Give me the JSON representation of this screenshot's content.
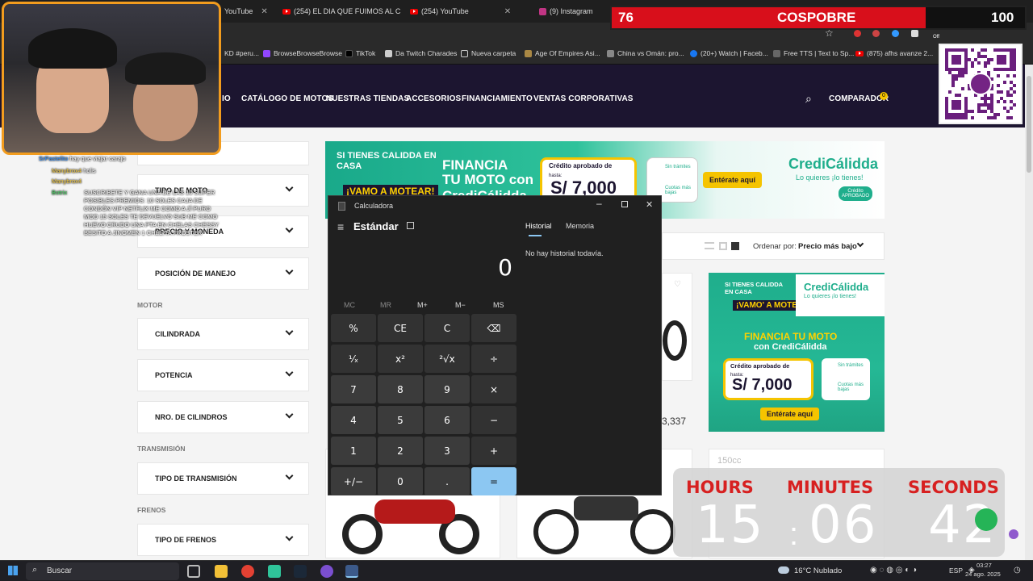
{
  "browser": {
    "tabs": [
      {
        "label": "YouTube"
      },
      {
        "label": "(254) EL DIA QUE FUIMOS AL C"
      },
      {
        "label": "(254) YouTube"
      },
      {
        "label": "(9) Instagram"
      }
    ],
    "bookmarks": [
      "KD #peru...",
      "BrowseBrowseBrowse",
      "TikTok",
      "Da Twitch Charades",
      "Nueva carpeta",
      "Age Of Empires Asi...",
      "China vs Omán: pro...",
      "(20+) Watch | Faceb...",
      "Free TTS | Text to Sp...",
      "(875) afhs avanze 2..."
    ],
    "off_label": "Off"
  },
  "site": {
    "nav": [
      "IO",
      "CATÁLOGO DE MOTOS",
      "NUESTRAS TIENDAS",
      "ACCESORIOS",
      "FINANCIAMIENTO",
      "VENTAS CORPORATIVAS"
    ],
    "comparador": "COMPARADOR",
    "comparador_count": "0",
    "filters": {
      "tipo_moto": "TIPO DE MOTO",
      "precio": "PRECIO Y MONEDA",
      "posicion": "POSICIÓN DE MANEJO",
      "motor_section": "MOTOR",
      "cilindrada": "CILINDRADA",
      "potencia": "POTENCIA",
      "nro_cilindros": "NRO. DE CILINDROS",
      "transmision_section": "TRANSMISIÓN",
      "tipo_transmision": "TIPO DE TRANSMISIÓN",
      "frenos_section": "FRENOS",
      "tipo_frenos": "TIPO DE FRENOS"
    },
    "banner": {
      "left_text": "SI TIENES CALIDDA EN CASA",
      "vamo": "¡VAMO A MOTEAR!",
      "financia_line1": "FINANCIA",
      "financia_line2": "TU MOTO con",
      "financia_line3": "CrediCálidda",
      "credito": "Crédito aprobado de",
      "hasta": "hasta:",
      "amount": "S/ 7,000",
      "sin_tramites": "Sin trámites",
      "cuotas": "Cuotas más bajas",
      "button": "Entérate aquí",
      "brand": "CrediCálidda",
      "tagline": "Lo quieres ¡lo tienes!",
      "stamp": "Crédito APROBADO"
    },
    "sort_label": "Ordenar por:",
    "sort_value": "Precio más bajo",
    "promo": {
      "top": "SI TIENES CALIDDA EN CASA",
      "vamo": "¡VAMO' A MOTEAR!",
      "brand": "CrediCálidda",
      "tagline": "Lo quieres ¡lo tienes!",
      "financia": "FINANCIA TU MOTO",
      "con": "con CrediCálidda",
      "credito": "Crédito aprobado de",
      "hasta": "hasta:",
      "amount": "S/ 7,000",
      "sin": "Sin trámites",
      "cuotas": "Cuotas más bajas",
      "button": "Entérate aquí"
    },
    "price_partial": "3,337",
    "cc_label": "150cc"
  },
  "calculator": {
    "title": "Calculadora",
    "mode": "Estándar",
    "display": "0",
    "history_tab": "Historial",
    "memory_tab": "Memoria",
    "history_empty": "No hay historial todavía.",
    "memory_buttons": [
      "MC",
      "MR",
      "M+",
      "M−",
      "MS"
    ],
    "keys": [
      [
        "%",
        "CE",
        "C",
        "⌫"
      ],
      [
        "¹⁄ₓ",
        "x²",
        "²√x",
        "÷"
      ],
      [
        "7",
        "8",
        "9",
        "×"
      ],
      [
        "4",
        "5",
        "6",
        "−"
      ],
      [
        "1",
        "2",
        "3",
        "+"
      ],
      [
        "+/−",
        "0",
        ".",
        "="
      ]
    ]
  },
  "overlay": {
    "score_left": "76",
    "score_title": "COSPOBRE",
    "score_right": "100",
    "score_fill": 0.76,
    "timer": {
      "hours_label": "HOURS",
      "minutes_label": "MINUTES",
      "seconds_label": "SECONDS",
      "hours": "15",
      "minutes": "06",
      "seconds": "42"
    },
    "chat": [
      {
        "user": "SrPastelito",
        "msg": "hay que viajar carajo"
      },
      {
        "user": "Manybrox4",
        "msg": "holis"
      },
      {
        "user": "Manybrox4",
        "msg": ""
      },
      {
        "user": "Botrix",
        "msg": "SUSCRIBETE Y GANA UNA DE LAS 10 SUPER POSIBLES PREMIOS: 10 SOLES CAJA DE CONDÓN VIP NETFLIX ME COMO A JÍ PURO MOD 15 SOLES TE DEVUELVO SUB ME COMO HUEVO CRUDO UNA PTA EN CHELAS CHESSY BESITO A JINOMEN 1 CHELITA FROSTER"
      }
    ]
  },
  "taskbar": {
    "search": "Buscar",
    "weather": "16°C  Nublado",
    "lang": "ESP",
    "time": "03:27",
    "date": "24 ago. 2025"
  },
  "colors": {
    "accent": "#8cc7f2",
    "site_header": "#1c1530",
    "brand_green": "#1fae8c",
    "timer_red": "#d72020",
    "score_red": "#d80f1b"
  }
}
